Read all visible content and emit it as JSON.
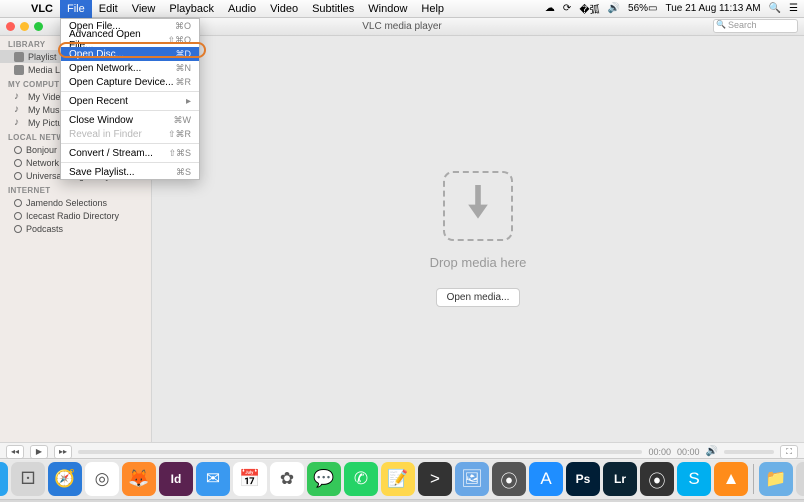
{
  "menubar": {
    "app": "VLC",
    "items": [
      "File",
      "Edit",
      "View",
      "Playback",
      "Audio",
      "Video",
      "Subtitles",
      "Window",
      "Help"
    ],
    "active_index": 0,
    "battery": "56%",
    "datetime": "Tue 21 Aug  11:13 AM"
  },
  "window": {
    "title": "VLC media player",
    "search_placeholder": "Search"
  },
  "file_menu": [
    {
      "label": "Open File...",
      "shortcut": "⌘O"
    },
    {
      "label": "Advanced Open File...",
      "shortcut": "⇧⌘O"
    },
    {
      "label": "Open Disc...",
      "shortcut": "⌘D",
      "highlight": true
    },
    {
      "label": "Open Network...",
      "shortcut": "⌘N"
    },
    {
      "label": "Open Capture Device...",
      "shortcut": "⌘R"
    },
    {
      "sep": true
    },
    {
      "label": "Open Recent",
      "submenu": true
    },
    {
      "sep": true
    },
    {
      "label": "Close Window",
      "shortcut": "⌘W"
    },
    {
      "label": "Reveal in Finder",
      "shortcut": "⇧⌘R",
      "disabled": true
    },
    {
      "sep": true
    },
    {
      "label": "Convert / Stream...",
      "shortcut": "⇧⌘S"
    },
    {
      "sep": true
    },
    {
      "label": "Save Playlist...",
      "shortcut": "⌘S"
    }
  ],
  "sidebar": {
    "groups": [
      {
        "name": "LIBRARY",
        "items": [
          {
            "label": "Playlist",
            "sel": true,
            "ic": "sq"
          },
          {
            "label": "Media Library",
            "ic": "sq"
          }
        ]
      },
      {
        "name": "MY COMPUTER",
        "items": [
          {
            "label": "My Videos",
            "ic": "note"
          },
          {
            "label": "My Music",
            "ic": "note"
          },
          {
            "label": "My Pictures",
            "ic": "note"
          }
        ]
      },
      {
        "name": "LOCAL NETWORK",
        "items": [
          {
            "label": "Bonjour Network",
            "ic": "round"
          },
          {
            "label": "Network streams",
            "ic": "round"
          },
          {
            "label": "Universal Plug'n'Play",
            "ic": "round"
          }
        ]
      },
      {
        "name": "INTERNET",
        "items": [
          {
            "label": "Jamendo Selections",
            "ic": "round"
          },
          {
            "label": "Icecast Radio Directory",
            "ic": "round"
          },
          {
            "label": "Podcasts",
            "ic": "round"
          }
        ]
      }
    ]
  },
  "main": {
    "drop_text": "Drop media here",
    "open_button": "Open media..."
  },
  "controls": {
    "time_elapsed": "00:00",
    "time_total": "00:00"
  },
  "dock": {
    "apps": [
      {
        "name": "finder",
        "color": "#2aa3ef",
        "glyph": "☺"
      },
      {
        "name": "launchpad",
        "color": "#d6d6d6",
        "glyph": "⚀"
      },
      {
        "name": "safari",
        "color": "#2b7bd9",
        "glyph": "🧭"
      },
      {
        "name": "chrome",
        "color": "#ffffff",
        "glyph": "◎"
      },
      {
        "name": "firefox",
        "color": "#ff8a2a",
        "glyph": "🦊"
      },
      {
        "name": "indesign",
        "color": "#5a2250",
        "glyph": "Id"
      },
      {
        "name": "mail",
        "color": "#3a99f0",
        "glyph": "✉"
      },
      {
        "name": "calendar",
        "color": "#ffffff",
        "glyph": "📅"
      },
      {
        "name": "photos",
        "color": "#ffffff",
        "glyph": "✿"
      },
      {
        "name": "messages",
        "color": "#35c759",
        "glyph": "💬"
      },
      {
        "name": "whatsapp",
        "color": "#25d366",
        "glyph": "✆"
      },
      {
        "name": "notes",
        "color": "#ffd84d",
        "glyph": "📝"
      },
      {
        "name": "terminal",
        "color": "#333",
        "glyph": ">"
      },
      {
        "name": "preview",
        "color": "#6aa7e6",
        "glyph": "🖼"
      },
      {
        "name": "activity",
        "color": "#555",
        "glyph": "⦿"
      },
      {
        "name": "appstore",
        "color": "#1f8eff",
        "glyph": "A"
      },
      {
        "name": "photoshop",
        "color": "#001e36",
        "glyph": "Ps"
      },
      {
        "name": "lightroom",
        "color": "#0a2433",
        "glyph": "Lr"
      },
      {
        "name": "capture",
        "color": "#333",
        "glyph": "⦿"
      },
      {
        "name": "skype",
        "color": "#00aff0",
        "glyph": "S"
      },
      {
        "name": "vlc",
        "color": "#ff8c1a",
        "glyph": "▲"
      }
    ],
    "right": [
      {
        "name": "folder",
        "color": "#6cb0e6",
        "glyph": "📁"
      },
      {
        "name": "trash",
        "color": "#d6d6d6",
        "glyph": "🗑"
      }
    ]
  }
}
